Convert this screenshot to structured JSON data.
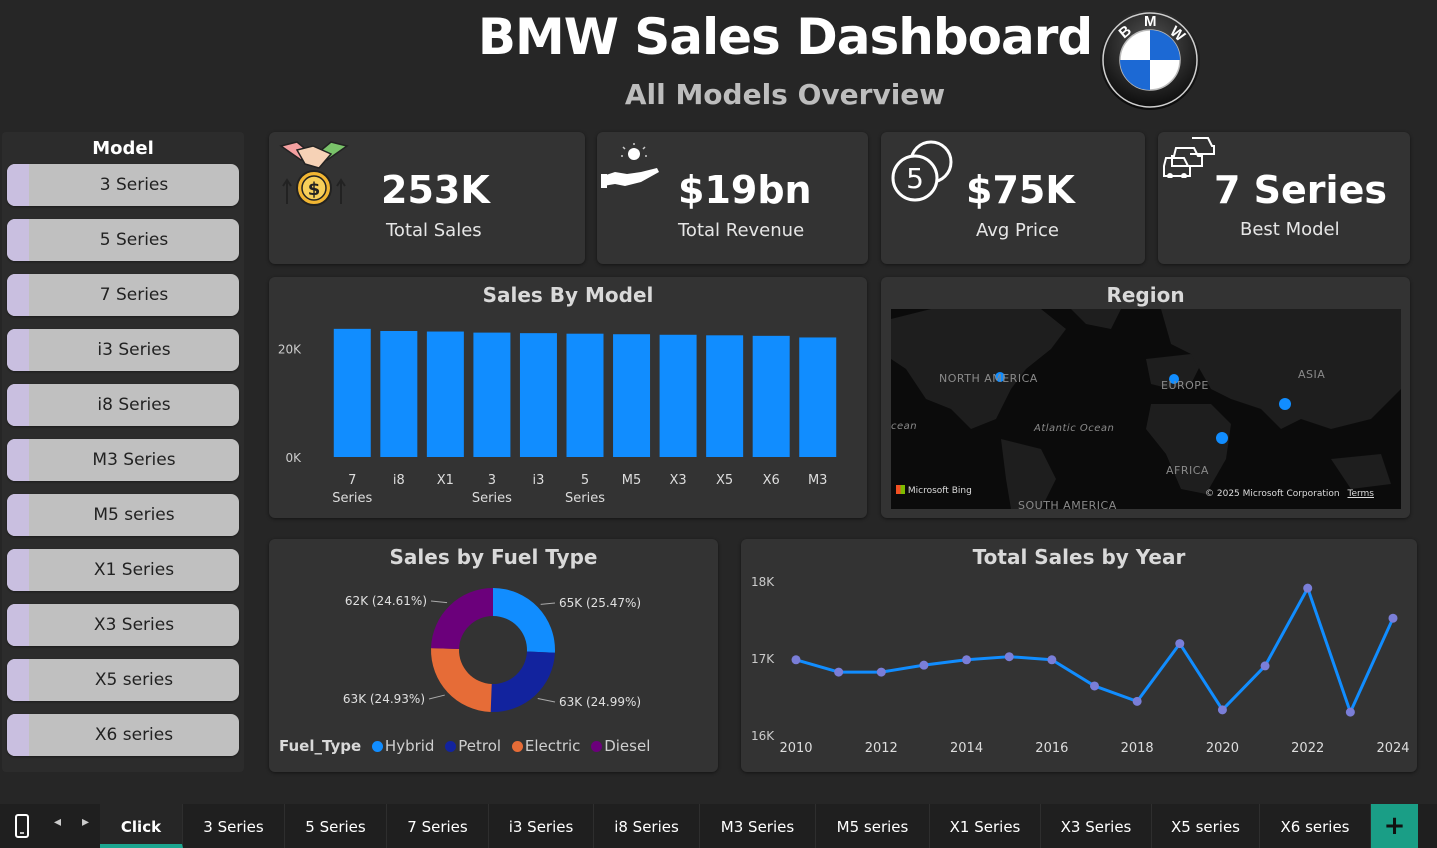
{
  "header": {
    "title": "BMW Sales Dashboard",
    "subtitle": "All Models Overview",
    "logo_letters": "BMW"
  },
  "slicer": {
    "title": "Model",
    "items": [
      "3 Series",
      "5 Series",
      "7 Series",
      "i3 Series",
      "i8 Series",
      "M3 Series",
      "M5 series",
      "X1 Series",
      "X3 Series",
      "X5 series",
      "X6 series"
    ]
  },
  "kpis": [
    {
      "value": "253K",
      "label": "Total Sales",
      "icon": "handshake-money-icon"
    },
    {
      "value": "$19bn",
      "label": "Total Revenue",
      "icon": "hand-coin-icon"
    },
    {
      "value": "$75K",
      "label": "Avg Price",
      "icon": "coins-icon"
    },
    {
      "value": "7 Series",
      "label": "Best Model",
      "icon": "cars-icon"
    }
  ],
  "map": {
    "title": "Region",
    "labels": {
      "na": "NORTH AMERICA",
      "eu": "EUROPE",
      "asia": "ASIA",
      "africa": "AFRICA",
      "sa": "SOUTH AMERICA",
      "atlantic": "Atlantic Ocean",
      "ocean": "cean"
    },
    "attribution": "Microsoft Bing",
    "copyright": "© 2025 Microsoft Corporation",
    "terms": "Terms"
  },
  "colors": {
    "bar": "#118dff",
    "hybrid": "#118dff",
    "petrol": "#12239e",
    "electric": "#e66c37",
    "diesel": "#6b007b",
    "line": "#118dff",
    "accent_tab": "#1ba58f"
  },
  "chart_data": [
    {
      "type": "bar",
      "title": "Sales By Model",
      "categories": [
        "7 Series",
        "i8",
        "X1",
        "3 Series",
        "i3",
        "5 Series",
        "M5",
        "X3",
        "X5",
        "X6",
        "M3"
      ],
      "tick_lines": [
        [
          "7",
          "Series"
        ],
        [
          "i8"
        ],
        [
          "X1"
        ],
        [
          "3",
          "Series"
        ],
        [
          "i3"
        ],
        [
          "5",
          "Series"
        ],
        [
          "M5"
        ],
        [
          "X3"
        ],
        [
          "X5"
        ],
        [
          "X6"
        ],
        [
          "M3"
        ]
      ],
      "values": [
        23800,
        23400,
        23300,
        23100,
        23000,
        22900,
        22800,
        22700,
        22600,
        22500,
        22200
      ],
      "yticks": [
        "0K",
        "20K"
      ],
      "ylim": [
        0,
        26000
      ],
      "grid": false
    },
    {
      "type": "pie",
      "title": "Sales by Fuel Type",
      "legend_title": "Fuel_Type",
      "series": [
        {
          "name": "Hybrid",
          "value": 65000,
          "label": "65K (25.47%)"
        },
        {
          "name": "Petrol",
          "value": 63000,
          "label": "63K (24.99%)"
        },
        {
          "name": "Electric",
          "value": 63000,
          "label": "63K (24.93%)"
        },
        {
          "name": "Diesel",
          "value": 62000,
          "label": "62K (24.61%)"
        }
      ],
      "legend_position": "bottom-left"
    },
    {
      "type": "line",
      "title": "Total Sales by Year",
      "x": [
        2010,
        2011,
        2012,
        2013,
        2014,
        2015,
        2016,
        2017,
        2018,
        2019,
        2020,
        2021,
        2022,
        2023,
        2024
      ],
      "values": [
        16990,
        16830,
        16830,
        16920,
        16990,
        17030,
        16990,
        16650,
        16450,
        17200,
        16340,
        16910,
        17920,
        16310,
        17530
      ],
      "xticks": [
        "2010",
        "2012",
        "2014",
        "2016",
        "2018",
        "2020",
        "2022",
        "2024"
      ],
      "yticks": [
        "16K",
        "17K",
        "18K"
      ],
      "ylim": [
        16000,
        18000
      ],
      "grid": false
    }
  ],
  "tabs": {
    "items": [
      "Click",
      "3 Series",
      "5 Series",
      "7 Series",
      "i3 Series",
      "i8 Series",
      "M3 Series",
      "M5 series",
      "X1 Series",
      "X3 Series",
      "X5 series",
      "X6 series"
    ],
    "active": "Click",
    "add": "+"
  }
}
